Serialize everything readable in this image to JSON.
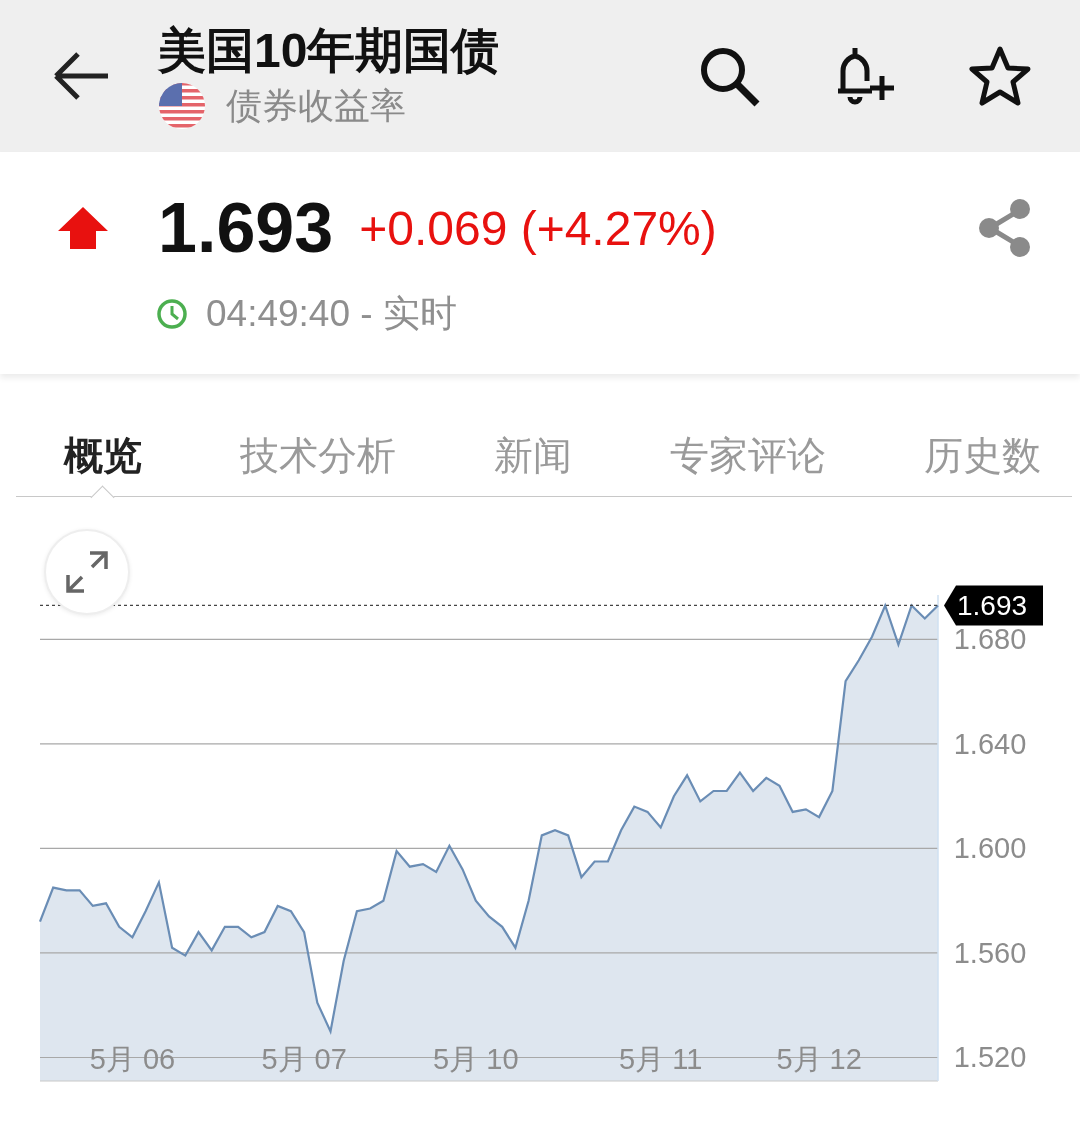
{
  "header": {
    "title": "美国10年期国债",
    "subtitle": "债券收益率"
  },
  "quote": {
    "price": "1.693",
    "change": "+0.069 (+4.27%)",
    "rising": true,
    "time": "04:49:40 - 实时"
  },
  "tabs": [
    {
      "label": "概览",
      "selected": true
    },
    {
      "label": "技术分析",
      "selected": false
    },
    {
      "label": "新闻",
      "selected": false
    },
    {
      "label": "专家评论",
      "selected": false
    },
    {
      "label": "历史数",
      "selected": false
    }
  ],
  "chart": {
    "chart_data": {
      "type": "area",
      "categories": [
        null,
        null,
        null,
        null,
        null,
        null,
        null,
        "5月 06",
        null,
        null,
        null,
        null,
        null,
        null,
        null,
        null,
        null,
        null,
        null,
        null,
        "5月 07",
        null,
        null,
        null,
        null,
        null,
        null,
        null,
        null,
        null,
        null,
        null,
        null,
        "5月 10",
        null,
        null,
        null,
        null,
        null,
        null,
        null,
        null,
        null,
        null,
        null,
        null,
        null,
        "5月 11",
        null,
        null,
        null,
        null,
        null,
        null,
        null,
        null,
        null,
        null,
        null,
        "5月 12",
        null,
        null,
        null,
        null,
        null,
        null,
        null,
        null,
        null
      ],
      "series": [
        {
          "color": "#6a8db5",
          "values": [
            1.572,
            1.585,
            1.584,
            1.584,
            1.578,
            1.579,
            1.57,
            1.566,
            1.576,
            1.587,
            1.562,
            1.559,
            1.568,
            1.561,
            1.57,
            1.57,
            1.566,
            1.568,
            1.578,
            1.576,
            1.568,
            1.541,
            1.53,
            1.557,
            1.576,
            1.577,
            1.58,
            1.599,
            1.593,
            1.594,
            1.591,
            1.601,
            1.592,
            1.58,
            1.574,
            1.57,
            1.562,
            1.58,
            1.605,
            1.607,
            1.605,
            1.589,
            1.595,
            1.595,
            1.607,
            1.616,
            1.614,
            1.608,
            1.62,
            1.628,
            1.618,
            1.622,
            1.622,
            1.629,
            1.622,
            1.627,
            1.624,
            1.614,
            1.615,
            1.612,
            1.622,
            1.664,
            1.672,
            1.681,
            1.693,
            1.678,
            1.693,
            1.688,
            1.693
          ]
        }
      ],
      "grid": true,
      "ylim": [
        1.511,
        1.697
      ],
      "yticks": [
        {
          "value": 1.52,
          "label": "1.520"
        },
        {
          "value": 1.56,
          "label": "1.560"
        },
        {
          "value": 1.6,
          "label": "1.600"
        },
        {
          "value": 1.64,
          "label": "1.640"
        },
        {
          "value": 1.68,
          "label": "1.680"
        }
      ],
      "ref_lines": [
        {
          "axis": "y",
          "value": 1.693,
          "label": "1.693"
        }
      ]
    }
  }
}
